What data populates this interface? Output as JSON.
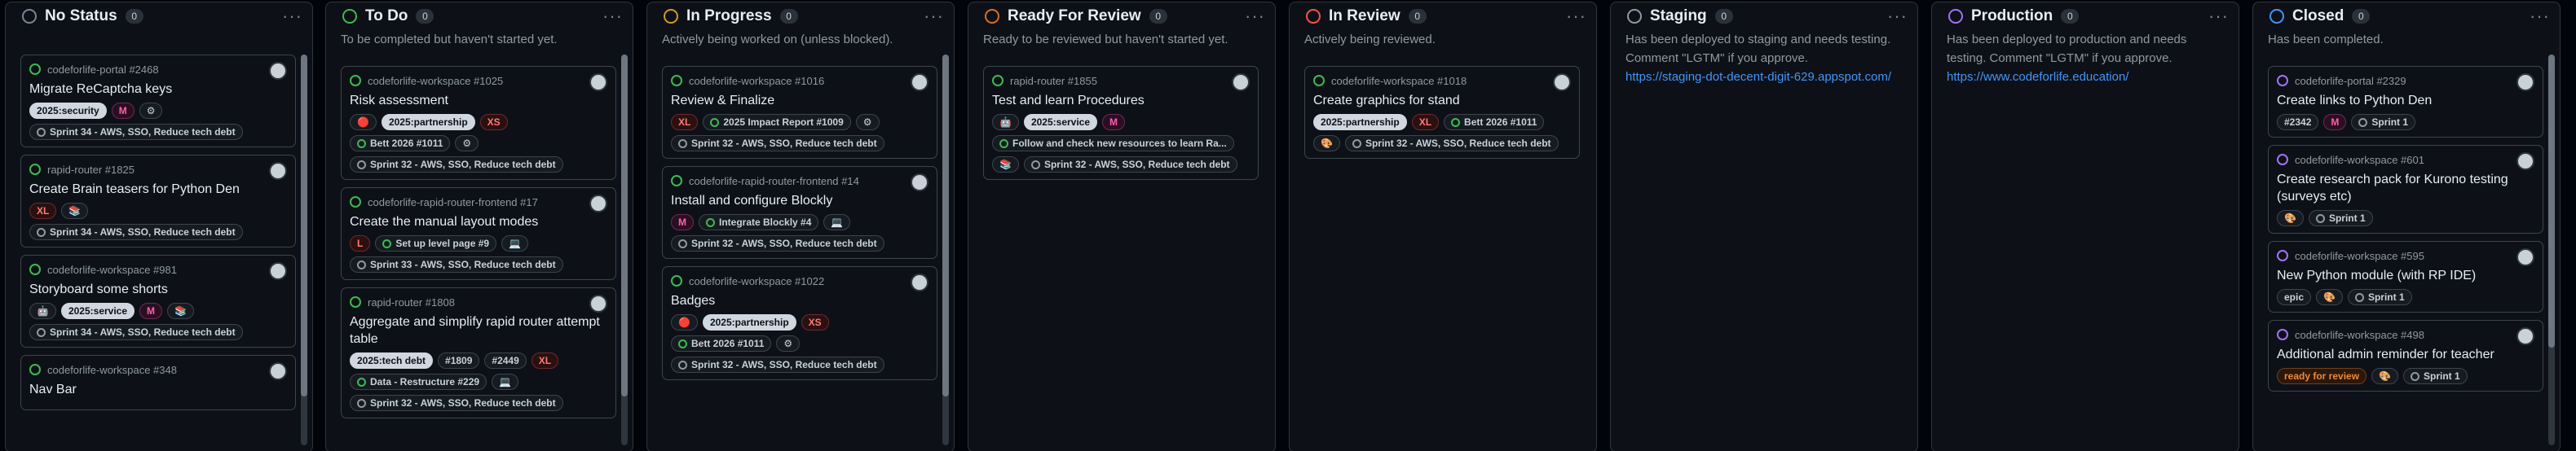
{
  "columns": [
    {
      "title": "No Status",
      "count": "0",
      "dot_color": "#7d8590",
      "description": "",
      "cards": [
        {
          "repo": "codeforlife-portal #2468",
          "title": "Migrate ReCaptcha keys",
          "labels": [
            "2025:security",
            "M",
            "⚙"
          ],
          "extra": [
            "Sprint 34 - AWS, SSO, Reduce tech debt"
          ]
        },
        {
          "repo": "rapid-router #1825",
          "title": "Create Brain teasers for Python Den",
          "labels": [
            "XL",
            "📚"
          ],
          "extra": [
            "Sprint 34 - AWS, SSO, Reduce tech debt"
          ]
        },
        {
          "repo": "codeforlife-workspace #981",
          "title": "Storyboard some shorts",
          "labels": [
            "🤖",
            "2025:service",
            "M",
            "📚"
          ],
          "extra": [
            "Sprint 34 - AWS, SSO, Reduce tech debt"
          ]
        },
        {
          "repo": "codeforlife-workspace #348",
          "title": "Nav Bar",
          "labels": [],
          "extra": []
        }
      ]
    },
    {
      "title": "To Do",
      "count": "0",
      "dot_color": "#3fb950",
      "description": "To be completed but haven't started yet.",
      "cards": [
        {
          "repo": "codeforlife-workspace #1025",
          "title": "Risk assessment",
          "labels": [
            "🔴",
            "2025:partnership",
            "XS"
          ],
          "extra": [
            "Bett 2026 #1011",
            "⚙",
            "Sprint 32 - AWS, SSO, Reduce tech debt"
          ]
        },
        {
          "repo": "codeforlife-rapid-router-frontend #17",
          "title": "Create the manual layout modes",
          "labels": [
            "L",
            "Set up level page #9",
            "💻"
          ],
          "extra": [
            "Sprint 33 - AWS, SSO, Reduce tech debt"
          ]
        },
        {
          "repo": "rapid-router #1808",
          "title": "Aggregate and simplify rapid router attempt table",
          "labels": [
            "2025:tech debt",
            "#1809",
            "#2449",
            "XL"
          ],
          "extra": [
            "Data - Restructure #229",
            "💻",
            "Sprint 32 - AWS, SSO, Reduce tech debt"
          ]
        }
      ]
    },
    {
      "title": "In Progress",
      "count": "0",
      "dot_color": "#d29922",
      "description": "Actively being worked on (unless blocked).",
      "cards": [
        {
          "repo": "codeforlife-workspace #1016",
          "title": "Review & Finalize",
          "labels": [
            "XL",
            "2025 Impact Report #1009",
            "⚙"
          ],
          "extra": [
            "Sprint 32 - AWS, SSO, Reduce tech debt"
          ]
        },
        {
          "repo": "codeforlife-rapid-router-frontend #14",
          "title": "Install and configure Blockly",
          "labels": [
            "M",
            "Integrate Blockly #4",
            "💻"
          ],
          "extra": [
            "Sprint 32 - AWS, SSO, Reduce tech debt"
          ]
        },
        {
          "repo": "codeforlife-workspace #1022",
          "title": "Badges",
          "labels": [
            "🔴",
            "2025:partnership",
            "XS"
          ],
          "extra": [
            "Bett 2026 #1011",
            "⚙",
            "Sprint 32 - AWS, SSO, Reduce tech debt"
          ]
        }
      ]
    },
    {
      "title": "Ready For Review",
      "count": "0",
      "dot_color": "#db6d28",
      "description": "Ready to be reviewed but haven't started yet.",
      "cards": [
        {
          "repo": "rapid-router #1855",
          "title": "Test and learn Procedures",
          "labels": [
            "🤖",
            "2025:service",
            "M"
          ],
          "extra": [
            "Follow and check new resources to learn Ra...",
            "📚",
            "Sprint 32 - AWS, SSO, Reduce tech debt"
          ]
        }
      ]
    },
    {
      "title": "In Review",
      "count": "0",
      "dot_color": "#f85149",
      "description": "Actively being reviewed.",
      "cards": [
        {
          "repo": "codeforlife-workspace #1018",
          "title": "Create graphics for stand",
          "labels": [
            "2025:partnership",
            "XL",
            "Bett 2026 #1011"
          ],
          "extra": [
            "🎨",
            "Sprint 32 - AWS, SSO, Reduce tech debt"
          ]
        }
      ]
    },
    {
      "title": "Staging",
      "count": "0",
      "dot_color": "#9198a1",
      "description": "Has been deployed to staging and needs testing. Comment \"LGTM\" if you approve.",
      "link": "https://staging-dot-decent-digit-629.appspot.com/",
      "cards": []
    },
    {
      "title": "Production",
      "count": "0",
      "dot_color": "#a371f7",
      "description": "Has been deployed to production and needs testing. Comment \"LGTM\" if you approve.",
      "link": "https://www.codeforlife.education/",
      "cards": []
    },
    {
      "title": "Closed",
      "count": "0",
      "dot_color": "#4493f8",
      "description": "Has been completed.",
      "cards": [
        {
          "repo": "codeforlife-portal #2329",
          "title": "Create links to Python Den",
          "labels": [
            "#2342",
            "M",
            "Sprint 1"
          ],
          "extra": []
        },
        {
          "repo": "codeforlife-workspace #601",
          "title": "Create research pack for Kurono testing (surveys etc)",
          "labels": [
            "🎨",
            "Sprint 1"
          ],
          "extra": []
        },
        {
          "repo": "codeforlife-workspace #595",
          "title": "New Python module (with RP IDE)",
          "labels": [
            "epic",
            "🎨",
            "Sprint 1"
          ],
          "extra": []
        },
        {
          "repo": "codeforlife-workspace #498",
          "title": "Additional admin reminder for teacher",
          "labels": [
            "ready for review",
            "🎨",
            "Sprint 1"
          ],
          "extra": []
        }
      ]
    }
  ],
  "more_glyph": "···"
}
